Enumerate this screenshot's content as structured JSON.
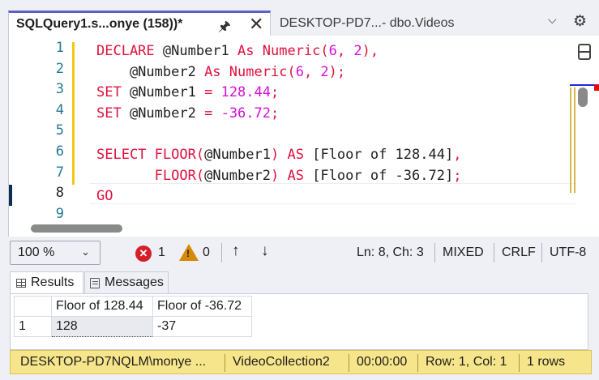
{
  "tabs": {
    "active": {
      "title": "SQLQuery1.s...onye (158))*"
    },
    "inactive": {
      "title": "DESKTOP-PD7...- dbo.Videos"
    }
  },
  "editor": {
    "line_numbers": [
      "1",
      "2",
      "3",
      "4",
      "5",
      "6",
      "7",
      "8",
      "9"
    ],
    "lines": [
      [
        {
          "t": "DECLARE",
          "c": "kw"
        },
        {
          "t": " @Number1 ",
          "c": "txt"
        },
        {
          "t": "As",
          "c": "kw"
        },
        {
          "t": " ",
          "c": "txt"
        },
        {
          "t": "Numeric(",
          "c": "kw"
        },
        {
          "t": "6",
          "c": "num"
        },
        {
          "t": ", ",
          "c": "kw"
        },
        {
          "t": "2",
          "c": "num"
        },
        {
          "t": "),",
          "c": "kw"
        }
      ],
      [
        {
          "t": "    @Number2 ",
          "c": "txt"
        },
        {
          "t": "As",
          "c": "kw"
        },
        {
          "t": " ",
          "c": "txt"
        },
        {
          "t": "Numeric(",
          "c": "kw"
        },
        {
          "t": "6",
          "c": "num"
        },
        {
          "t": ", ",
          "c": "kw"
        },
        {
          "t": "2",
          "c": "num"
        },
        {
          "t": ");",
          "c": "kw"
        }
      ],
      [
        {
          "t": "SET",
          "c": "kw"
        },
        {
          "t": " @Number1 ",
          "c": "txt"
        },
        {
          "t": "=",
          "c": "kw"
        },
        {
          "t": " ",
          "c": "txt"
        },
        {
          "t": "128.44",
          "c": "num"
        },
        {
          "t": ";",
          "c": "kw"
        }
      ],
      [
        {
          "t": "SET",
          "c": "kw"
        },
        {
          "t": " @Number2 ",
          "c": "txt"
        },
        {
          "t": "=",
          "c": "kw"
        },
        {
          "t": " ",
          "c": "txt"
        },
        {
          "t": "-36.72",
          "c": "num"
        },
        {
          "t": ";",
          "c": "kw"
        }
      ],
      [],
      [
        {
          "t": "SELECT",
          "c": "kw"
        },
        {
          "t": " ",
          "c": "txt"
        },
        {
          "t": "FLOOR(",
          "c": "kw"
        },
        {
          "t": "@Number1",
          "c": "txt"
        },
        {
          "t": ")",
          "c": "kw"
        },
        {
          "t": " ",
          "c": "txt"
        },
        {
          "t": "AS",
          "c": "kw"
        },
        {
          "t": " [Floor of 128.44]",
          "c": "txt"
        },
        {
          "t": ",",
          "c": "kw"
        }
      ],
      [
        {
          "t": "       ",
          "c": "txt"
        },
        {
          "t": "FLOOR(",
          "c": "kw"
        },
        {
          "t": "@Number2",
          "c": "txt"
        },
        {
          "t": ")",
          "c": "kw"
        },
        {
          "t": " ",
          "c": "txt"
        },
        {
          "t": "AS",
          "c": "kw"
        },
        {
          "t": " [Floor of -36.72]",
          "c": "txt"
        },
        {
          "t": ";",
          "c": "kw"
        }
      ],
      [
        {
          "t": "GO",
          "c": "kw"
        }
      ],
      []
    ]
  },
  "editor_status": {
    "zoom": "100 %",
    "errors": "1",
    "warnings": "0",
    "position": "Ln: 8, Ch: 3",
    "line_endings_mixed": "MIXED",
    "line_ending": "CRLF",
    "encoding": "UTF-8"
  },
  "results": {
    "tabs": {
      "results": "Results",
      "messages": "Messages"
    },
    "columns": [
      "Floor of 128.44",
      "Floor of -36.72"
    ],
    "rows": [
      {
        "row_number": "1",
        "values": [
          "128",
          "-37"
        ]
      }
    ]
  },
  "statusbar": {
    "server": "DESKTOP-PD7NQLM\\monye ...",
    "database": "VideoCollection2",
    "elapsed": "00:00:00",
    "cursor": "Row: 1, Col: 1",
    "row_count": "1 rows"
  },
  "colors": {
    "keyword": "#e0113e",
    "number": "#d40fd8",
    "line_number": "#237893",
    "status_bar": "#f6e58a",
    "active_tab_accent": "#5b5fc7"
  }
}
